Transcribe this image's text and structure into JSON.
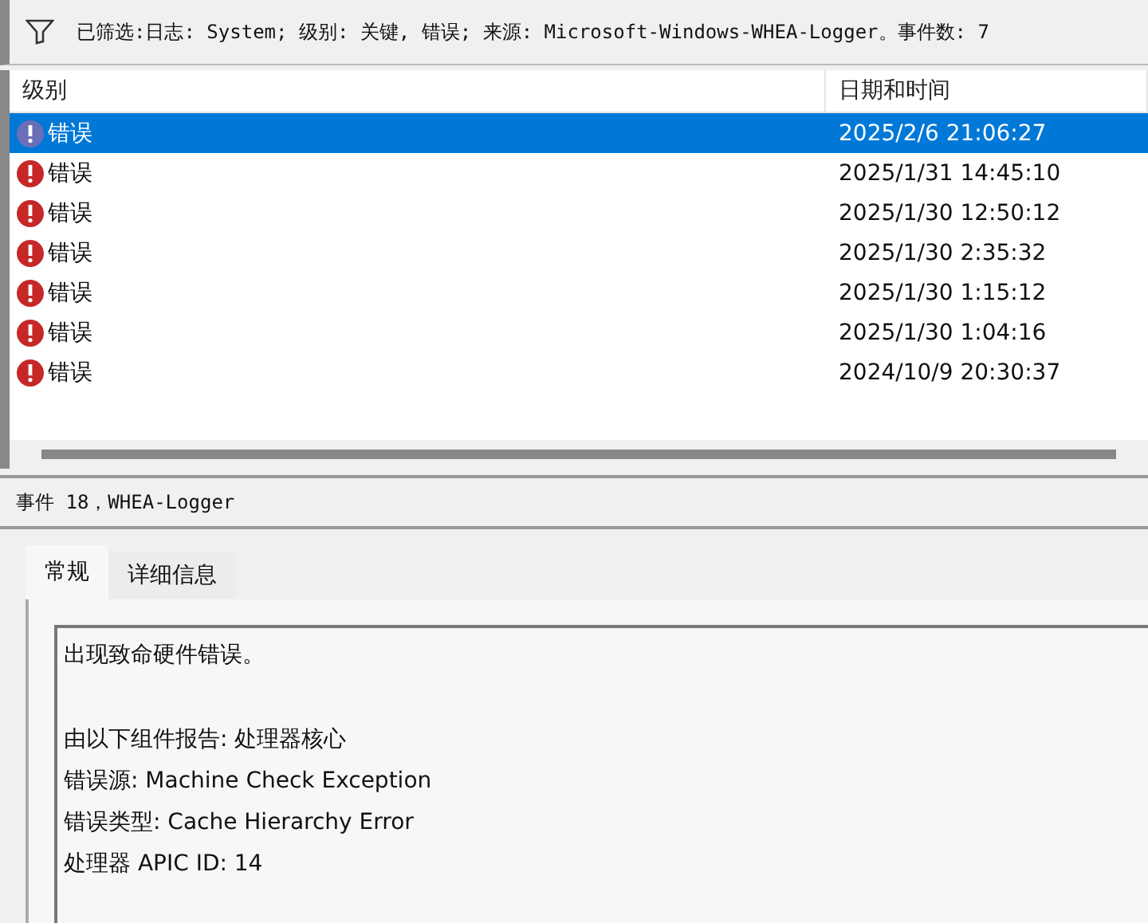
{
  "filter": {
    "text": "已筛选:日志: System; 级别: 关键, 错误; 来源: Microsoft-Windows-WHEA-Logger。事件数: 7"
  },
  "table": {
    "columns": [
      "级别",
      "日期和时间"
    ],
    "rows": [
      {
        "level": "错误",
        "datetime": "2025/2/6 21:06:27",
        "selected": true
      },
      {
        "level": "错误",
        "datetime": "2025/1/31 14:45:10",
        "selected": false
      },
      {
        "level": "错误",
        "datetime": "2025/1/30 12:50:12",
        "selected": false
      },
      {
        "level": "错误",
        "datetime": "2025/1/30 2:35:32",
        "selected": false
      },
      {
        "level": "错误",
        "datetime": "2025/1/30 1:15:12",
        "selected": false
      },
      {
        "level": "错误",
        "datetime": "2025/1/30 1:04:16",
        "selected": false
      },
      {
        "level": "错误",
        "datetime": "2024/10/9 20:30:37",
        "selected": false
      }
    ]
  },
  "event": {
    "title": "事件 18，WHEA-Logger",
    "tabs": [
      {
        "label": "常规",
        "selected": true
      },
      {
        "label": "详细信息",
        "selected": false
      }
    ],
    "message": "出现致命硬件错误。",
    "details": [
      "由以下组件报告: 处理器核心",
      "错误源: Machine Check Exception",
      "错误类型: Cache Hierarchy Error",
      "处理器 APIC ID: 14"
    ]
  }
}
